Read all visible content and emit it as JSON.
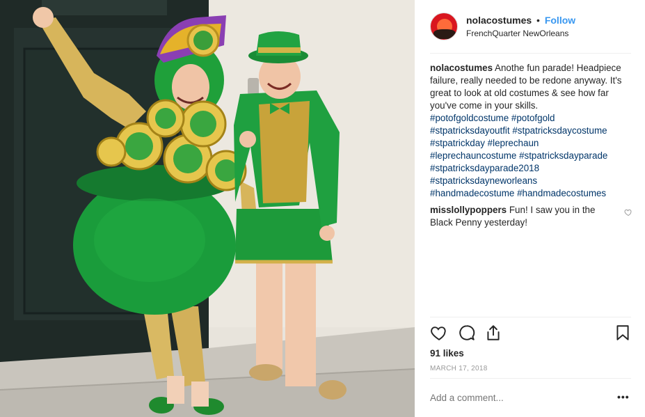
{
  "post": {
    "photo": {
      "alt_icon": "photo-image"
    },
    "header": {
      "username": "nolacostumes",
      "separator": "•",
      "follow_label": "Follow",
      "location": "FrenchQuarter NewOrleans"
    },
    "caption": {
      "username": "nolacostumes",
      "line1": "Anothe fun parade! Headpiece",
      "line2": "failure, really needed to be redone anyway. It's",
      "line3": "great to look at old costumes & see how far",
      "line4": "you've come in your skills.",
      "tags": [
        "#potofgoldcostume",
        "#potofgold",
        "#stpatricksdayoutfit",
        "#stpatricksdaycostume",
        "#stpatrickday",
        "#leprechaun",
        "#leprechauncostume",
        "#stpatricksdayparade",
        "#stpatricksdayparade2018",
        "#stpatricksdayneworleans",
        "#handmadecostume",
        "#handmadecostumes"
      ]
    },
    "comment": {
      "username": "misslollypoppers",
      "line1": "Fun! I saw you in the",
      "line2": "Black Penny yesterday!"
    },
    "actions": {
      "like_icon": "heart-icon",
      "comment_icon": "comment-icon",
      "share_icon": "share-icon",
      "save_icon": "bookmark-icon"
    },
    "likes": "91 likes",
    "date": "MARCH 17, 2018",
    "add_comment_placeholder": "Add a comment...",
    "more_options": "•••"
  },
  "colors": {
    "link": "#3897f0",
    "hashtag": "#003569",
    "text": "#262626",
    "muted": "#999999",
    "divider": "#efefef"
  }
}
